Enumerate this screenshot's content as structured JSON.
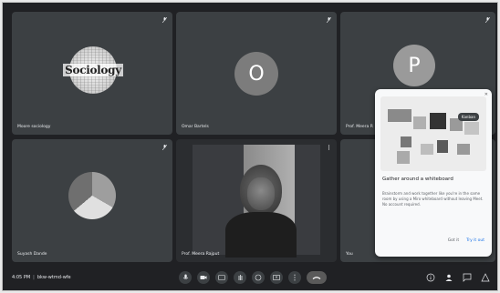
{
  "participants": [
    {
      "name": "Moore sociology",
      "avatar_text": "Sociology"
    },
    {
      "name": "Omar Bartels",
      "avatar_letter": "O",
      "avatar_color": "#e06a3b"
    },
    {
      "name": "Prof. Meera R",
      "avatar_letter": "P",
      "avatar_color": "#7b8ea3"
    },
    {
      "name": "Suyash Dande"
    },
    {
      "name": "Prof. Meera Rajput"
    },
    {
      "name": "You"
    }
  ],
  "bottom_bar": {
    "time": "4:05 PM",
    "meeting_code": "bkw-wtmd-wfe"
  },
  "popup": {
    "title": "Gather around a whiteboard",
    "body": "Brainstorm and work together like you're in the same room by using a Miro whiteboard without leaving Meet. No account required.",
    "dismiss_label": "Got it",
    "try_label": "Try it out",
    "tag": "Kanban"
  },
  "colors": {
    "background": "#202124",
    "tile": "#3c4043",
    "accent": "#8ab4f8"
  }
}
